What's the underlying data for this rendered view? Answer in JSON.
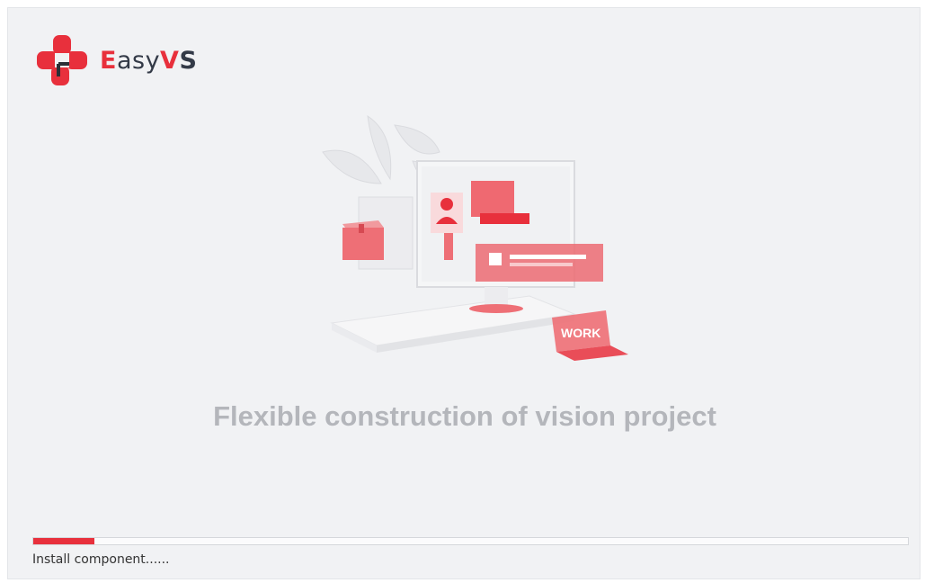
{
  "app": {
    "logo_text_red1": "E",
    "logo_text_dark1": "asy",
    "logo_text_red2": "V",
    "logo_text_dark2": "S"
  },
  "illustration": {
    "monitor_label": "WORK"
  },
  "tagline": "Flexible construction of vision project",
  "progress": {
    "fraction": 0.07,
    "status_text": "Install component......"
  },
  "colors": {
    "accent": "#e8303c",
    "background": "#f1f2f4",
    "text_dark": "#333a47",
    "tagline": "#b4b6bb"
  }
}
